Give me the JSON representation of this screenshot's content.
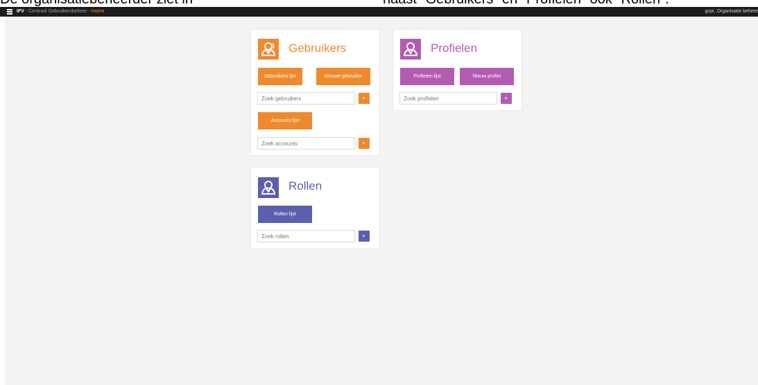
{
  "colors": {
    "gebruikers": "#f0892c",
    "profielen": "#b35bb1",
    "rollen": "#5c5fae",
    "topbar": "#1c1c1c",
    "content_bg": "#f3f3f3"
  },
  "caption": {
    "left": "De organisatiebeheerder ziet in",
    "right": "naast \"Gebruikers\" en \"Profielen\" ook \"Rollen\"."
  },
  "topbar": {
    "brand": "IFV",
    "separator1": " - ",
    "app_name": "Centraal Gebruikersbeheer",
    "separator2": " - ",
    "home": "Home",
    "user": "gopi, Organisatie beheer",
    "menu_icon": "hamburger-icon"
  },
  "cards": {
    "gebruikers": {
      "title": "Gebruikers",
      "icon": "user-icon",
      "list_button": "Gebruikers lijst",
      "new_button": "Nieuwe gebruiker",
      "search_placeholder": "Zoek gebruikers",
      "accounts_button": "Accounts lijst",
      "accounts_search_placeholder": "Zoek accounts",
      "go_symbol": "►"
    },
    "profielen": {
      "title": "Profielen",
      "icon": "profile-icon",
      "list_button": "Profielen lijst",
      "new_button": "Nieuw profiel",
      "search_placeholder": "Zoek profielen",
      "go_symbol": "►"
    },
    "rollen": {
      "title": "Rollen",
      "icon": "role-icon",
      "list_button": "Rollen lijst",
      "search_placeholder": "Zoek rollen",
      "go_symbol": "►"
    }
  }
}
